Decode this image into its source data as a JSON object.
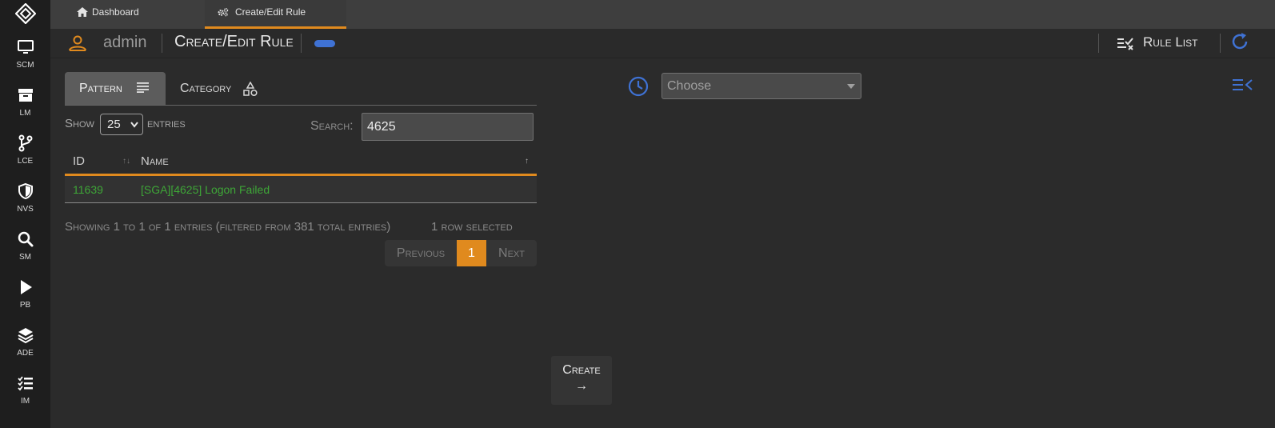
{
  "sidebar": {
    "items": [
      {
        "label": "SCM",
        "icon": "monitor-icon"
      },
      {
        "label": "LM",
        "icon": "archive-icon"
      },
      {
        "label": "LCE",
        "icon": "branch-icon"
      },
      {
        "label": "NVS",
        "icon": "shield-icon"
      },
      {
        "label": "SM",
        "icon": "search-icon"
      },
      {
        "label": "PB",
        "icon": "play-icon"
      },
      {
        "label": "ADE",
        "icon": "layers-icon"
      },
      {
        "label": "IM",
        "icon": "checklist-icon"
      }
    ]
  },
  "tabs": [
    {
      "label": "Dashboard",
      "icon": "home-icon"
    },
    {
      "label": "Create/Edit Rule",
      "icon": "cogs-icon",
      "active": true
    }
  ],
  "header": {
    "username": "admin",
    "title": "Create/Edit Rule",
    "rule_list_label": "Rule List"
  },
  "left_panel": {
    "subtabs": [
      {
        "label": "Pattern",
        "active": true
      },
      {
        "label": "Category"
      }
    ],
    "show_label": "Show",
    "entries_value": "25",
    "entries_label": "entries",
    "search_label": "Search:",
    "search_value": "4625",
    "columns": [
      "ID",
      "Name"
    ],
    "rows": [
      {
        "id": "11639",
        "name": "[SGA][4625] Logon Failed"
      }
    ],
    "info_text": "Showing 1 to 1 of 1 entries (filtered from 381 total entries)",
    "selected_text": "1 row selected",
    "pagination": {
      "previous": "Previous",
      "current": "1",
      "next": "Next"
    },
    "create_label": "Create",
    "create_arrow": "→"
  },
  "right_panel": {
    "choose_placeholder": "Choose"
  },
  "colors": {
    "accent": "#e08a1e",
    "blue": "#3f72d4",
    "match_green": "#3ea637",
    "sidebar_bg": "#1e1e1e",
    "content_bg": "#2b2b2b"
  }
}
